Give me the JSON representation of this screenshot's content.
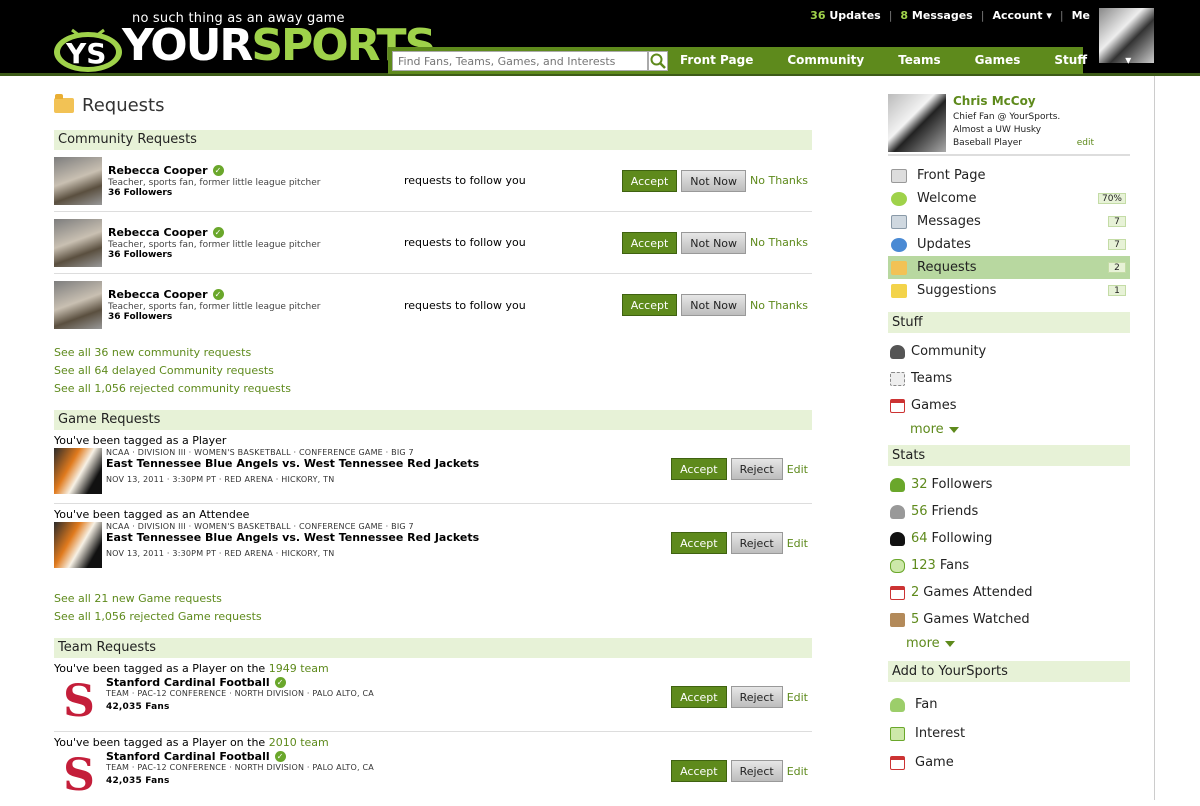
{
  "header": {
    "tagline": "no such thing as an away game",
    "logo_your": "YOUR",
    "logo_sports": "SPORTS",
    "search_placeholder": "Find Fans, Teams, Games, and Interests",
    "nav": [
      "Front Page",
      "Community",
      "Teams",
      "Games",
      "Stuff"
    ],
    "updates_count": "36",
    "updates_label": "Updates",
    "messages_count": "8",
    "messages_label": "Messages",
    "account_label": "Account",
    "me_label": "Me"
  },
  "page": {
    "title": "Requests"
  },
  "community": {
    "heading": "Community Requests",
    "rows": [
      {
        "name": "Rebecca Cooper",
        "desc": "Teacher, sports fan, former little league pitcher",
        "followers": "36 Followers",
        "action": "requests to follow you"
      },
      {
        "name": "Rebecca Cooper",
        "desc": "Teacher, sports fan, former little league pitcher",
        "followers": "36 Followers",
        "action": "requests to follow you"
      },
      {
        "name": "Rebecca Cooper",
        "desc": "Teacher, sports fan, former little league pitcher",
        "followers": "36 Followers",
        "action": "requests to follow you"
      }
    ],
    "accept": "Accept",
    "not_now": "Not Now",
    "no_thanks": "No Thanks",
    "see_all": [
      {
        "pre": "See all",
        "num": "36",
        "post": "new community requests"
      },
      {
        "pre": "See all",
        "num": "64",
        "post": "delayed Community requests"
      },
      {
        "pre": "See all",
        "num": "1,056",
        "post": "rejected community requests"
      }
    ]
  },
  "game": {
    "heading": "Game Requests",
    "rows": [
      {
        "tag": "You've been tagged as a Player",
        "meta": "NCAA  ·  DIVISION III  ·  WOMEN'S BASKETBALL  ·  CONFERENCE GAME  ·  BIG 7",
        "title": "East Tennessee Blue Angels vs. West Tennessee Red Jackets",
        "bottom": "NOV 13, 2011  ·  3:30PM PT  ·  RED ARENA  ·  HICKORY, TN"
      },
      {
        "tag": "You've been tagged as an Attendee",
        "meta": "NCAA  ·  DIVISION III  ·  WOMEN'S BASKETBALL  ·  CONFERENCE GAME  ·  BIG 7",
        "title": "East Tennessee Blue Angels vs. West Tennessee Red Jackets",
        "bottom": "NOV 13, 2011  ·  3:30PM PT  ·  RED ARENA  ·  HICKORY, TN"
      }
    ],
    "accept": "Accept",
    "reject": "Reject",
    "edit": "Edit",
    "see_all": [
      {
        "pre": "See all",
        "num": "21",
        "post": "new Game requests"
      },
      {
        "pre": "See all",
        "num": "1,056",
        "post": "rejected Game requests"
      }
    ]
  },
  "team": {
    "heading": "Team Requests",
    "rows": [
      {
        "tag_pre": "You've been tagged as a Player on the",
        "tag_link": "1949 team",
        "name": "Stanford Cardinal Football",
        "meta": "TEAM  ·  PAC-12 CONFERENCE  ·  NORTH DIVISION  ·  PALO ALTO, CA",
        "fans": "42,035 Fans"
      },
      {
        "tag_pre": "You've been tagged as a Player on the",
        "tag_link": "2010 team",
        "name": "Stanford Cardinal Football",
        "meta": "TEAM  ·  PAC-12 CONFERENCE  ·  NORTH DIVISION  ·  PALO ALTO, CA",
        "fans": "42,035 Fans"
      }
    ],
    "accept": "Accept",
    "reject": "Reject",
    "edit": "Edit",
    "logo_letter": "S"
  },
  "sidebar": {
    "profile": {
      "name": "Chris McCoy",
      "desc": "Chief Fan @ YourSports. Almost a UW Husky Baseball Player",
      "edit": "edit"
    },
    "menu": [
      {
        "label": "Front Page",
        "badge": ""
      },
      {
        "label": "Welcome",
        "badge": "70%"
      },
      {
        "label": "Messages",
        "badge": "7"
      },
      {
        "label": "Updates",
        "badge": "7"
      },
      {
        "label": "Requests",
        "badge": "2"
      },
      {
        "label": "Suggestions",
        "badge": "1"
      }
    ],
    "stuff_heading": "Stuff",
    "stuff": [
      "Community",
      "Teams",
      "Games"
    ],
    "more": "more",
    "stats_heading": "Stats",
    "stats": [
      {
        "num": "32",
        "label": "Followers"
      },
      {
        "num": "56",
        "label": "Friends"
      },
      {
        "num": "64",
        "label": "Following"
      },
      {
        "num": "123",
        "label": "Fans"
      },
      {
        "num": "2",
        "label": "Games Attended"
      },
      {
        "num": "5",
        "label": "Games Watched"
      }
    ],
    "add_heading": "Add to YourSports",
    "add": [
      "Fan",
      "Interest",
      "Game"
    ]
  },
  "colors": {
    "brand_green": "#5e8a1c",
    "light_green": "#e7f2d7",
    "logo_green": "#9fd24a",
    "stanford_red": "#c41e3a"
  }
}
